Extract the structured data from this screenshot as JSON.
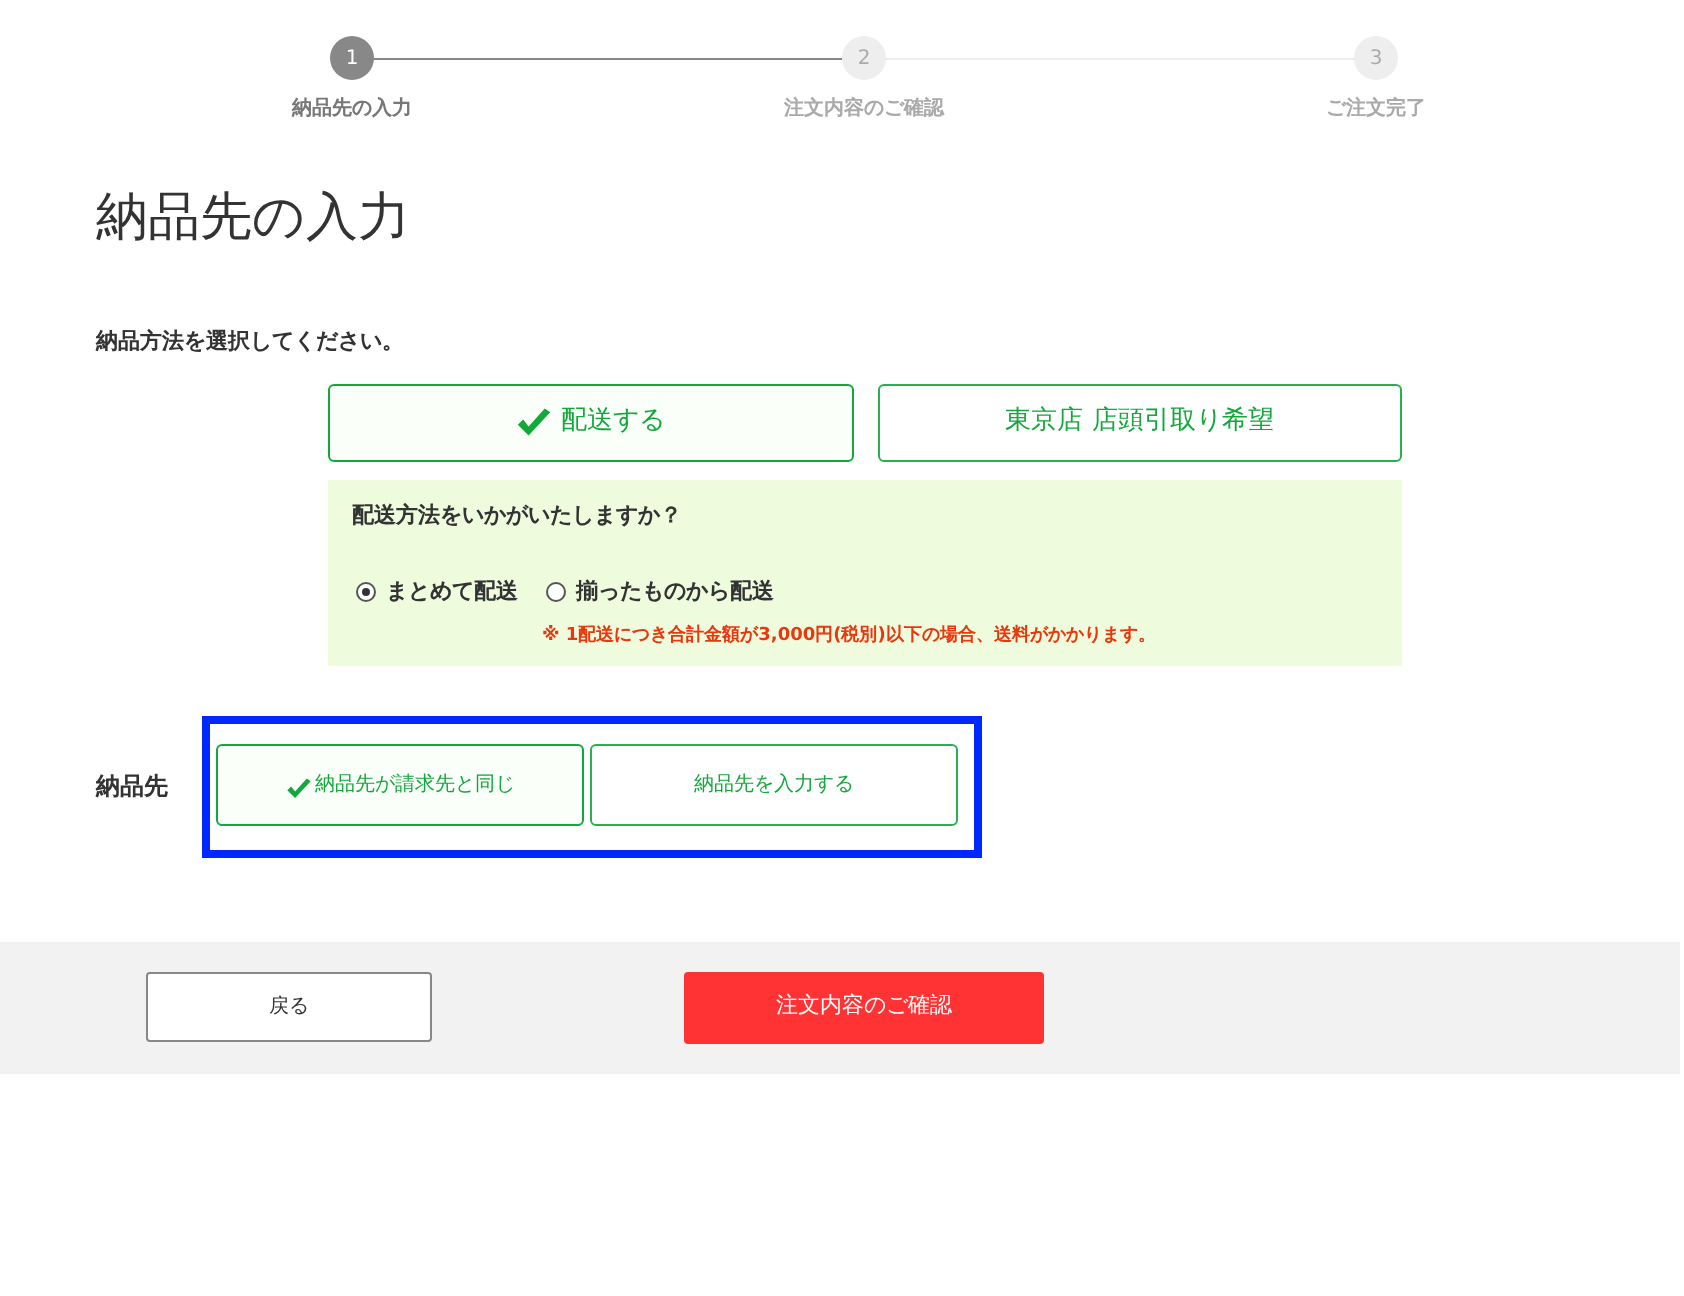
{
  "steps": [
    {
      "number": "1",
      "label": "納品先の入力",
      "selected": true
    },
    {
      "number": "2",
      "label": "注文内容のご確認",
      "selected": false
    },
    {
      "number": "3",
      "label": "ご注文完了",
      "selected": false
    }
  ],
  "page_title": "納品先の入力",
  "delivery_method": {
    "prompt": "納品方法を選択してください。",
    "options": [
      {
        "label": "配送する",
        "selected": true
      },
      {
        "label": "東京店 店頭引取り希望",
        "selected": false
      }
    ],
    "panel": {
      "question": "配送方法をいかがいたしますか？",
      "radios": [
        {
          "label": "まとめて配送",
          "selected": true
        },
        {
          "label": "揃ったものから配送",
          "selected": false
        }
      ],
      "note": "※ 1配送につき合計金額が3,000円(税別)以下の場合、送料がかかります。"
    }
  },
  "destination": {
    "label": "納品先",
    "options": [
      {
        "label": "納品先が請求先と同じ",
        "selected": true
      },
      {
        "label": "納品先を入力する",
        "selected": false
      }
    ]
  },
  "footer": {
    "back": "戻る",
    "confirm": "注文内容のご確認"
  }
}
